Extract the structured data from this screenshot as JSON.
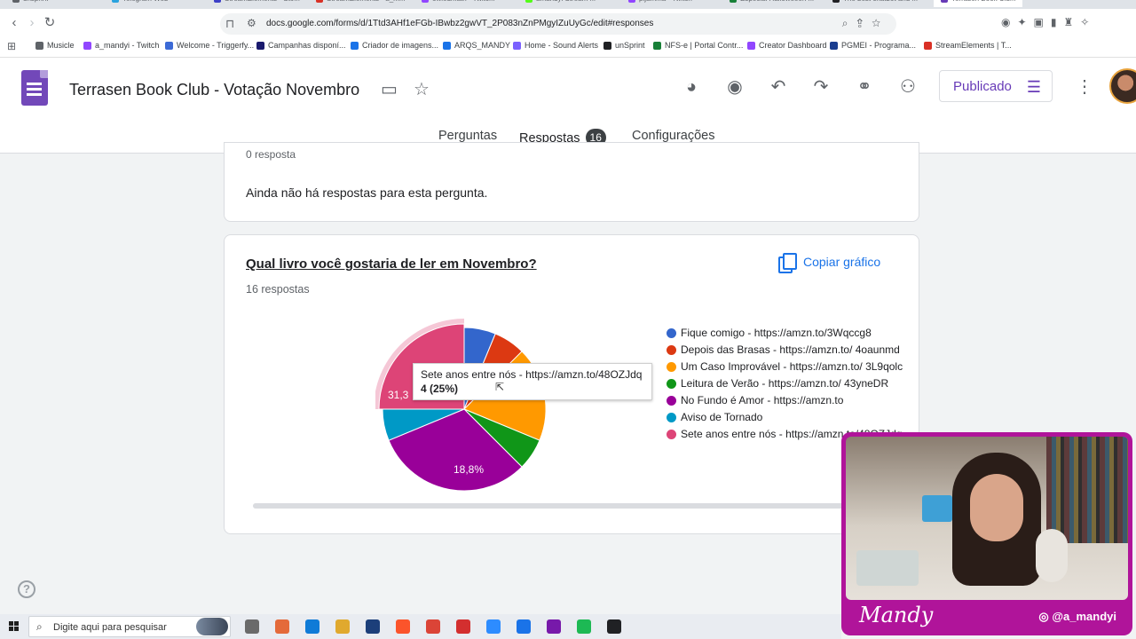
{
  "browser": {
    "tabs": [
      {
        "label": "unsprint",
        "color": "#5f6368"
      },
      {
        "label": "Telegram Web",
        "color": "#2aa3de"
      },
      {
        "label": "StreamElements - Sto...",
        "color": "#3c3fc7"
      },
      {
        "label": "StreamElements - a_m...",
        "color": "#d93025"
      },
      {
        "label": "owledmatn - Twitc...",
        "color": "#9146ff"
      },
      {
        "label": "amandyi Stream ...",
        "color": "#53fc18"
      },
      {
        "label": "pijamma - Twitch",
        "color": "#9146ff"
      },
      {
        "label": "Especial Halloweeen ...",
        "color": "#188038"
      },
      {
        "label": "The best chatbot and ...",
        "color": "#202124"
      },
      {
        "label": "Terrasen Book Clu...",
        "color": "#673ab7"
      }
    ],
    "url": "docs.google.com/forms/d/1Ttd3AHf1eFGb-IBwbz2gwVT_2P083nZnPMgyIZuUyGc/edit#responses",
    "bookmarks": [
      {
        "label": "Musicle",
        "color": "#5f6368"
      },
      {
        "label": "a_mandyi - Twitch",
        "color": "#9146ff"
      },
      {
        "label": "Welcome - Triggerfy...",
        "color": "#3c6ad6"
      },
      {
        "label": "Campanhas disponí...",
        "color": "#1a1a6e"
      },
      {
        "label": "Criador de imagens...",
        "color": "#1a73e8"
      },
      {
        "label": "ARQS_MANDY",
        "color": "#1a73e8"
      },
      {
        "label": "Home - Sound Alerts",
        "color": "#7b61ff"
      },
      {
        "label": "unSprint",
        "color": "#202124"
      },
      {
        "label": "NFS-e | Portal Contr...",
        "color": "#188038"
      },
      {
        "label": "Creator Dashboard",
        "color": "#9146ff"
      },
      {
        "label": "PGMEI - Programa...",
        "color": "#1a3d8f"
      },
      {
        "label": "StreamElements | T...",
        "color": "#d93025"
      }
    ]
  },
  "form": {
    "title": "Terrasen Book Club - Votação Novembro",
    "publish_label": "Publicado",
    "tabs": {
      "questions": "Perguntas",
      "responses": "Respostas",
      "responses_count": "16",
      "settings": "Configurações"
    }
  },
  "previous_card": {
    "cut_text": "0 resposta",
    "no_responses": "Ainda não há respostas para esta pergunta."
  },
  "question_card": {
    "title": "Qual livro você gostaria de ler em Novembro?",
    "response_count": "16 respostas",
    "copy_label": "Copiar gráfico",
    "tooltip": {
      "line1": "Sete anos entre nós - https://amzn.to/48OZJdq",
      "line2": "4 (25%)"
    },
    "visible_slice_labels": [
      "31,3",
      "18,8%"
    ]
  },
  "chart_data": {
    "type": "pie",
    "title": "Qual livro você gostaria de ler em Novembro?",
    "total": 16,
    "slices": [
      {
        "label": "Fique comigo - https://amzn.to/3Wqccg8",
        "value": 1,
        "color": "#3366cc"
      },
      {
        "label": "Depois das Brasas - https://amzn.to/ 4oaunmd",
        "value": 1,
        "color": "#dc3912"
      },
      {
        "label": "Um Caso Improvável - https://amzn.to/ 3L9qolc",
        "value": 3,
        "color": "#ff9900"
      },
      {
        "label": "Leitura de Verão - https://amzn.to/ 43yneDR",
        "value": 1,
        "color": "#109618"
      },
      {
        "label": "No Fundo é Amor - https://amzn.to",
        "value": 5,
        "color": "#990099"
      },
      {
        "label": "Aviso de Tornado",
        "value": 1,
        "color": "#0099c6"
      },
      {
        "label": "Sete anos entre nós - https://amzn.to/48OZJdq",
        "value": 4,
        "color": "#dd4477"
      }
    ],
    "highlighted": "Sete anos entre nós - https://amzn.to/48OZJdq",
    "legend_position": "right"
  },
  "webcam": {
    "name": "Mandy",
    "handle": "@a_mandyi"
  },
  "taskbar": {
    "search_placeholder": "Digite aqui para pesquisar",
    "apps": [
      "#6a6a6a",
      "#e46a3a",
      "#0f7bd7",
      "#e0a92e",
      "#1c3f7a",
      "#fb542b",
      "#db4437",
      "#d32f2f",
      "#2d8cff",
      "#1a73e8",
      "#7719aa",
      "#1db954",
      "#202124"
    ]
  }
}
